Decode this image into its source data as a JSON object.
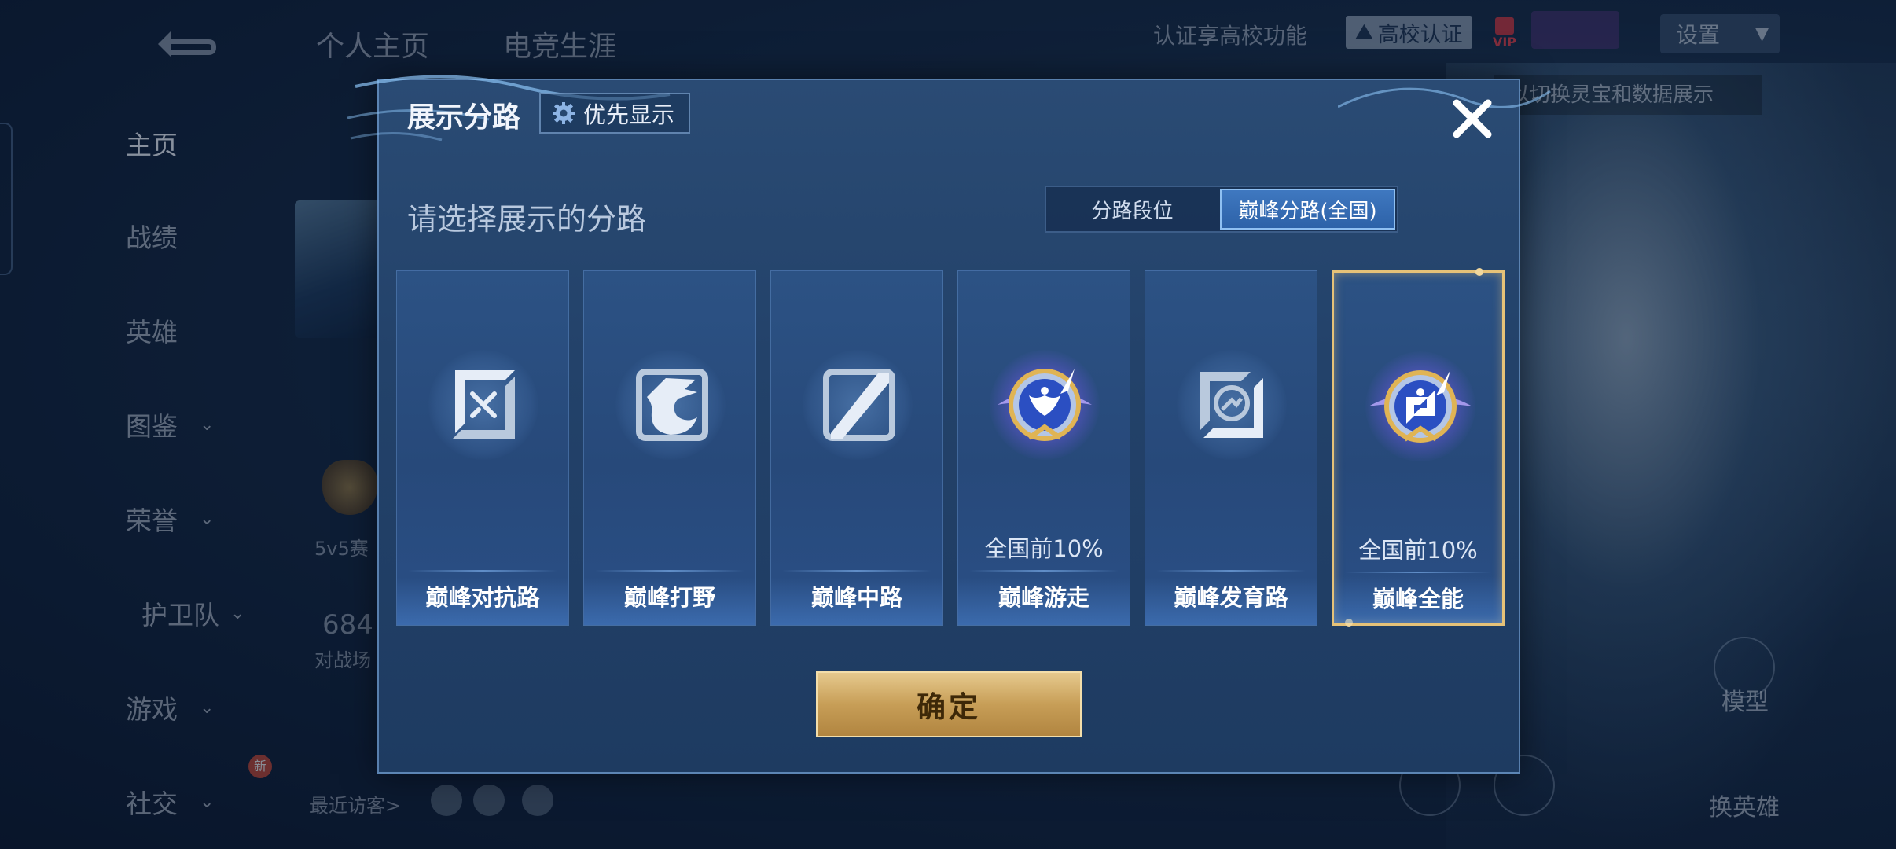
{
  "background": {
    "top_tabs": [
      "个人主页",
      "电竞生涯"
    ],
    "campus_auth_prompt": "认证享高校功能",
    "campus_badge": "高校认证",
    "vip_label": "VIP",
    "settings_label": "设置",
    "ticker_text": "以切换灵宝和数据展示",
    "sidebar_items": [
      {
        "label": "主页",
        "has_chevron": false
      },
      {
        "label": "战绩",
        "has_chevron": false
      },
      {
        "label": "英雄",
        "has_chevron": false
      },
      {
        "label": "图鉴",
        "has_chevron": true
      },
      {
        "label": "荣誉",
        "has_chevron": true
      },
      {
        "label": "护卫队",
        "has_chevron": true
      },
      {
        "label": "游戏",
        "has_chevron": true
      },
      {
        "label": "社交",
        "has_chevron": true
      }
    ],
    "new_tag": "新",
    "mode_label": "5v5赛",
    "stat_number": "684",
    "stat_label": "对战场",
    "recent_visitors": "最近访客>",
    "right_labels": {
      "model": "模型",
      "change_hero": "换英雄"
    }
  },
  "dialog": {
    "title": "展示分路",
    "priority_button": "优先显示",
    "subtitle": "请选择展示的分路",
    "tabs": [
      {
        "label": "分路段位",
        "active": false
      },
      {
        "label": "巅峰分路(全国)",
        "active": true
      }
    ],
    "cards": [
      {
        "label": "巅峰对抗路",
        "rank": "",
        "icon": "sword-icon",
        "ranked": false,
        "selected": false
      },
      {
        "label": "巅峰打野",
        "rank": "",
        "icon": "dragon-icon",
        "ranked": false,
        "selected": false
      },
      {
        "label": "巅峰中路",
        "rank": "",
        "icon": "slash-icon",
        "ranked": false,
        "selected": false
      },
      {
        "label": "巅峰游走",
        "rank": "全国前10%",
        "icon": "wings-emblem-icon",
        "ranked": true,
        "selected": false
      },
      {
        "label": "巅峰发育路",
        "rank": "",
        "icon": "target-icon",
        "ranked": false,
        "selected": false
      },
      {
        "label": "巅峰全能",
        "rank": "全国前10%",
        "icon": "allround-emblem-icon",
        "ranked": true,
        "selected": true
      }
    ],
    "confirm_button": "确定"
  },
  "colors": {
    "accent_gold": "#e6c278",
    "tab_active": "#3f78c0",
    "dialog_bg": "#23426a"
  }
}
